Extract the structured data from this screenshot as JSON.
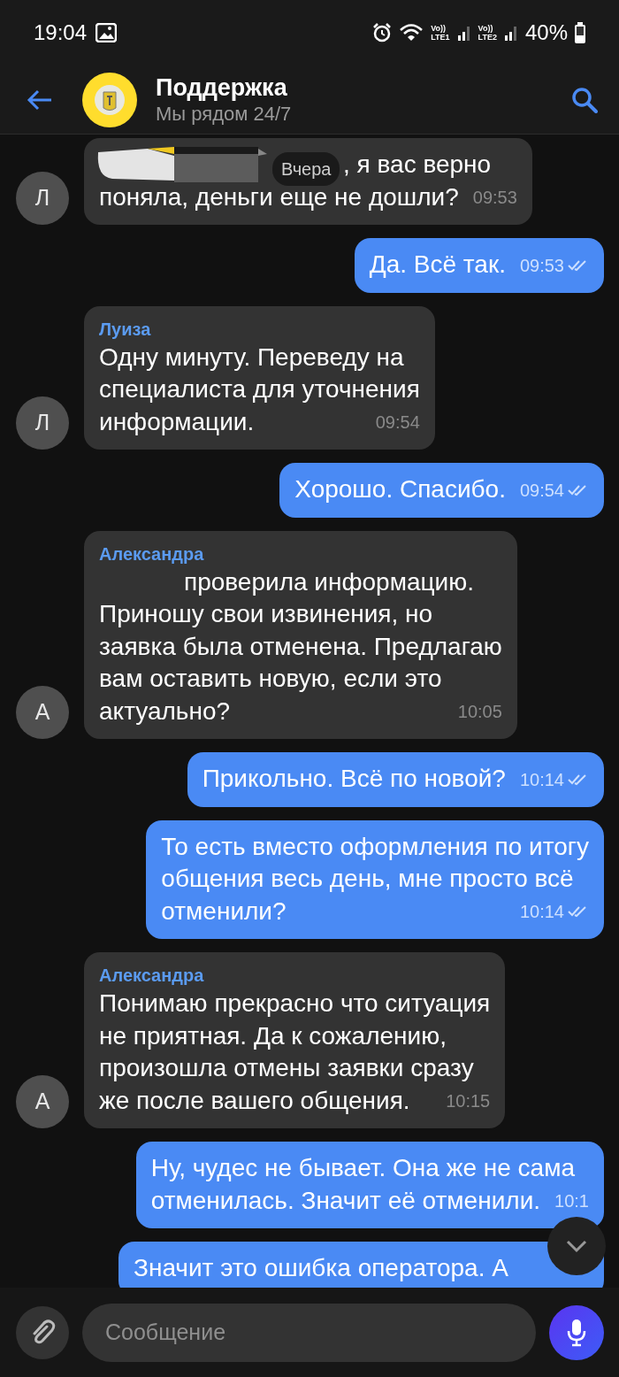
{
  "status_bar": {
    "time": "19:04",
    "sim_labels": [
      {
        "top": "Vo))",
        "bottom": "LTE1"
      },
      {
        "top": "Vo))",
        "bottom": "LTE2"
      }
    ],
    "battery": "40%"
  },
  "header": {
    "title": "Поддержка",
    "subtitle": "Мы рядом 24/7"
  },
  "date_pill": "Вчера",
  "messages": [
    {
      "kind": "received",
      "avatar": "Л",
      "lines": [
        {
          "kind": "scribbled",
          "text": ", я вас верно"
        },
        {
          "text": "поняла, деньги еще не дошли?"
        }
      ],
      "time": "09:53"
    },
    {
      "kind": "sent",
      "lines": [
        {
          "text": "Да. Всё так."
        }
      ],
      "time": "09:53",
      "read": true
    },
    {
      "kind": "received",
      "avatar": "Л",
      "sender": "Луиза",
      "lines": [
        {
          "text": "Одну минуту. Переведу на"
        },
        {
          "text": "специалиста для уточнения"
        },
        {
          "text": "информации."
        }
      ],
      "time": "09:54"
    },
    {
      "kind": "sent",
      "lines": [
        {
          "text": "Хорошо. Спасибо."
        }
      ],
      "time": "09:54",
      "read": true
    },
    {
      "kind": "received",
      "avatar": "А",
      "sender": "Александра",
      "lines": [
        {
          "kind": "erased",
          "text": "проверила информацию."
        },
        {
          "text": "Приношу свои извинения, но"
        },
        {
          "text": "заявка была отменена. Предлагаю"
        },
        {
          "text": "вам оставить новую, если это"
        },
        {
          "text": "актуально?"
        }
      ],
      "time": "10:05"
    },
    {
      "kind": "sent",
      "lines": [
        {
          "text": "Прикольно. Всё по новой?"
        }
      ],
      "time": "10:14",
      "read": true
    },
    {
      "kind": "sent",
      "lines": [
        {
          "text": "То есть вместо оформления по итогу"
        },
        {
          "text": "общения весь день, мне просто всё"
        },
        {
          "text": "отменили?"
        }
      ],
      "time": "10:14",
      "read": true
    },
    {
      "kind": "received",
      "avatar": "А",
      "sender": "Александра",
      "lines": [
        {
          "text": "Понимаю прекрасно что ситуация"
        },
        {
          "text": "не приятная. Да к сожалению,"
        },
        {
          "text": "произошла отмены заявки сразу"
        },
        {
          "text": "же после вашего общения."
        }
      ],
      "time": "10:15"
    },
    {
      "kind": "sent",
      "lines": [
        {
          "text": "Ну, чудес не бывает. Она же не сама"
        },
        {
          "text": "отменилась. Значит её отменили."
        }
      ],
      "time": "10:1"
    },
    {
      "kind": "sent",
      "lines": [
        {
          "text": "Значит это ошибка оператора. А"
        }
      ]
    }
  ],
  "composer": {
    "placeholder": "Сообщение"
  }
}
